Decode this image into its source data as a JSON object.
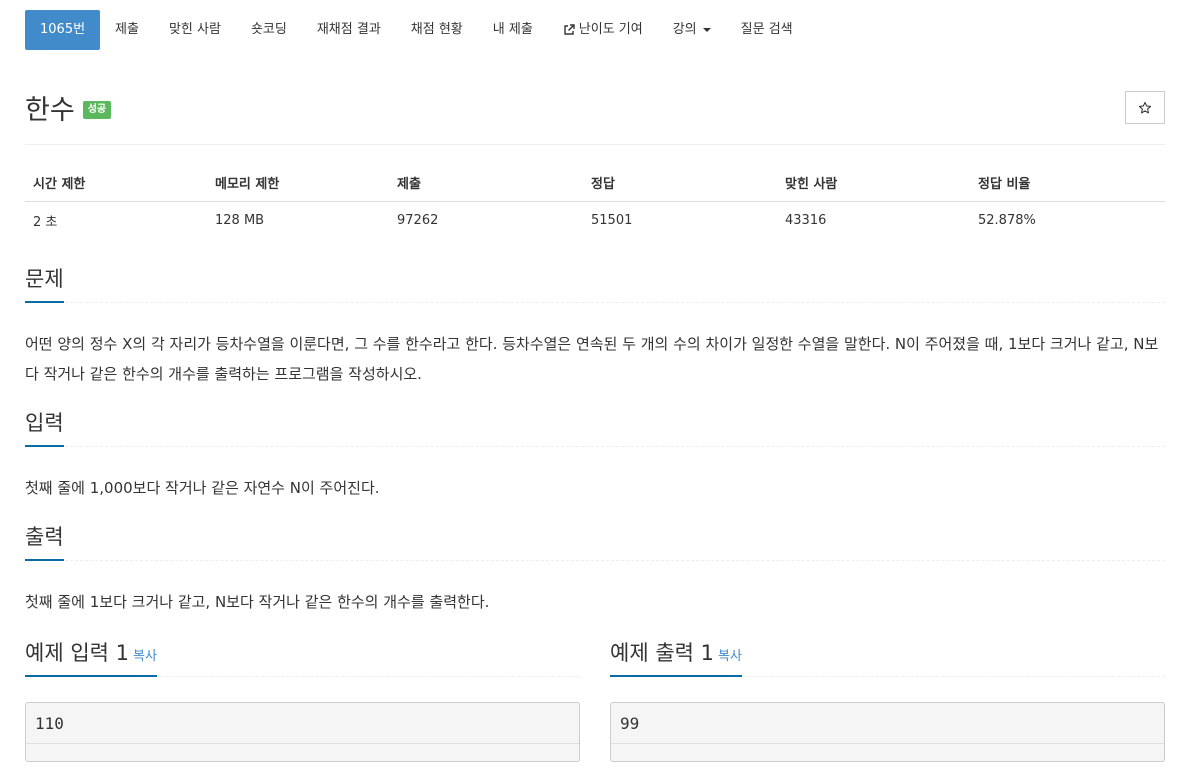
{
  "tabs": [
    {
      "label": "1065번"
    },
    {
      "label": "제출"
    },
    {
      "label": "맞힌 사람"
    },
    {
      "label": "숏코딩"
    },
    {
      "label": "재채점 결과"
    },
    {
      "label": "채점 현황"
    },
    {
      "label": "내 제출"
    },
    {
      "label": "난이도 기여",
      "icon": "external-link-icon"
    },
    {
      "label": "강의",
      "icon": "caret-down-icon"
    },
    {
      "label": "질문 검색"
    }
  ],
  "problem": {
    "title": "한수",
    "badge": "성공",
    "star_icon": "star-outline-icon"
  },
  "info_table": {
    "headers": [
      "시간 제한",
      "메모리 제한",
      "제출",
      "정답",
      "맞힌 사람",
      "정답 비율"
    ],
    "values": [
      "2 초",
      "128 MB",
      "97262",
      "51501",
      "43316",
      "52.878%"
    ]
  },
  "sections": {
    "description": {
      "heading": "문제",
      "text": "어떤 양의 정수 X의 각 자리가 등차수열을 이룬다면, 그 수를 한수라고 한다. 등차수열은 연속된 두 개의 수의 차이가 일정한 수열을 말한다. N이 주어졌을 때, 1보다 크거나 같고, N보다 작거나 같은 한수의 개수를 출력하는 프로그램을 작성하시오."
    },
    "input": {
      "heading": "입력",
      "text": "첫째 줄에 1,000보다 작거나 같은 자연수 N이 주어진다."
    },
    "output": {
      "heading": "출력",
      "text": "첫째 줄에 1보다 크거나 같고, N보다 작거나 같은 한수의 개수를 출력한다."
    },
    "sample_input": {
      "heading": "예제 입력 1",
      "copy_label": "복사",
      "value": "110"
    },
    "sample_output": {
      "heading": "예제 출력 1",
      "copy_label": "복사",
      "value": "99"
    }
  },
  "colors": {
    "active_tab": "#428bca",
    "badge_success": "#5cb85c",
    "section_underline": "#0b6ba6",
    "link": "#428bca"
  }
}
